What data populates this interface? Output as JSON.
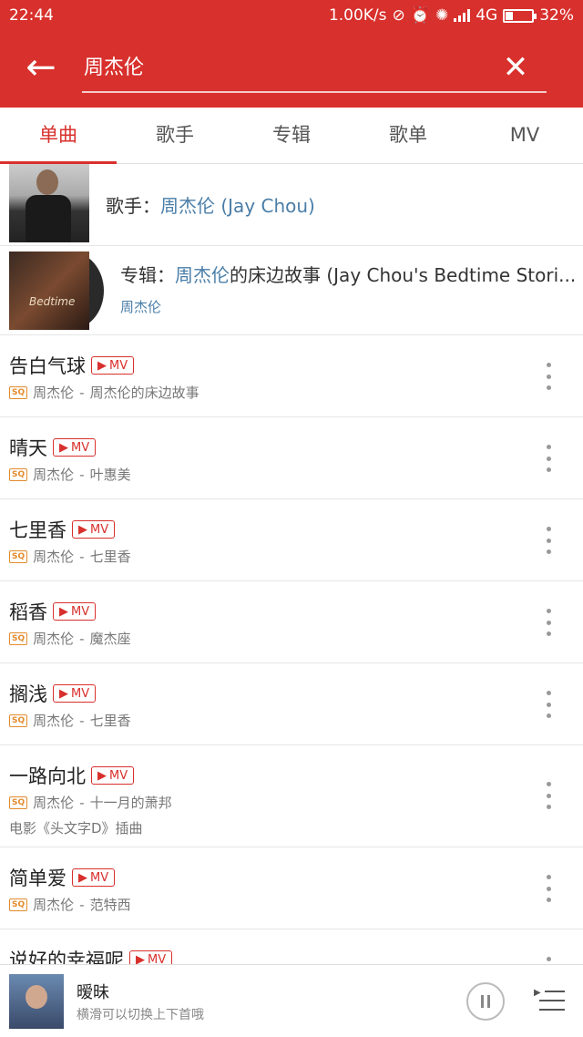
{
  "status_bar": {
    "time": "22:44",
    "speed": "1.00K/s",
    "network": "4G",
    "battery": "32%"
  },
  "search": {
    "query": "周杰伦"
  },
  "tabs": [
    {
      "label": "单曲",
      "active": true
    },
    {
      "label": "歌手",
      "active": false
    },
    {
      "label": "专辑",
      "active": false
    },
    {
      "label": "歌单",
      "active": false
    },
    {
      "label": "MV",
      "active": false
    }
  ],
  "artist_row": {
    "prefix": "歌手：",
    "name": "周杰伦 (Jay Chou)"
  },
  "album_row": {
    "prefix": "专辑：",
    "highlight": "周杰伦",
    "rest": "的床边故事 (Jay Chou's Bedtime Stori...",
    "artist": "周杰伦"
  },
  "badges": {
    "mv": "MV",
    "sq": "SQ"
  },
  "songs": [
    {
      "title": "告白气球",
      "artist": "周杰伦",
      "album": "周杰伦的床边故事",
      "note": ""
    },
    {
      "title": "晴天",
      "artist": "周杰伦",
      "album": "叶惠美",
      "note": ""
    },
    {
      "title": "七里香",
      "artist": "周杰伦",
      "album": "七里香",
      "note": ""
    },
    {
      "title": "稻香",
      "artist": "周杰伦",
      "album": "魔杰座",
      "note": ""
    },
    {
      "title": "搁浅",
      "artist": "周杰伦",
      "album": "七里香",
      "note": ""
    },
    {
      "title": "一路向北",
      "artist": "周杰伦",
      "album": "十一月的萧邦",
      "note": "电影《头文字D》插曲"
    },
    {
      "title": "简单爱",
      "artist": "周杰伦",
      "album": "范特西",
      "note": ""
    },
    {
      "title": "说好的幸福呢",
      "artist": "",
      "album": "",
      "note": ""
    }
  ],
  "player": {
    "title": "暧昧",
    "subtitle": "横滑可以切换上下首哦"
  },
  "colors": {
    "brand_red": "#d8302c",
    "link_blue": "#4a7ea8",
    "sq_orange": "#e38b2e"
  }
}
